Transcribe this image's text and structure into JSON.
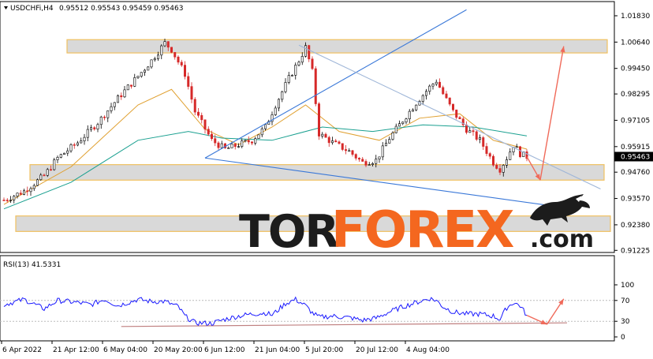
{
  "chart_data": [
    {
      "type": "candlestick",
      "header": {
        "symbol": "USDCHFi,H4",
        "values": "0.95512 0.95543 0.95459 0.95463"
      },
      "ylim": [
        0.912,
        1.024
      ],
      "y_ticks": [
        "1.01830",
        "1.00640",
        "0.99450",
        "0.98295",
        "0.97105",
        "0.95915",
        "0.94760",
        "0.93570",
        "0.92380",
        "0.91225"
      ],
      "y_tick_values": [
        1.0183,
        1.0064,
        0.9945,
        0.98295,
        0.97105,
        0.95915,
        0.9476,
        0.9357,
        0.9238,
        0.91225
      ],
      "current_price": "0.95463",
      "x_labels": [
        "6 Apr 2022",
        "21 Apr 12:00",
        "6 May 04:00",
        "20 May 20:00",
        "6 Jun 12:00",
        "21 Jun 04:00",
        "5 Jul 20:00",
        "20 Jul 12:00",
        "4 Aug 04:00"
      ],
      "price_path": [
        [
          0,
          0.935
        ],
        [
          6,
          0.939
        ],
        [
          12,
          0.946
        ],
        [
          16,
          0.954
        ],
        [
          22,
          0.961
        ],
        [
          28,
          0.97
        ],
        [
          34,
          0.981
        ],
        [
          40,
          0.991
        ],
        [
          44,
          0.998
        ],
        [
          48,
          1.006
        ],
        [
          50,
          1.003
        ],
        [
          54,
          0.992
        ],
        [
          57,
          0.975
        ],
        [
          62,
          0.962
        ],
        [
          66,
          0.958
        ],
        [
          70,
          0.96
        ],
        [
          74,
          0.962
        ],
        [
          78,
          0.968
        ],
        [
          81,
          0.978
        ],
        [
          85,
          0.99
        ],
        [
          88,
          0.998
        ],
        [
          90,
          1.004
        ],
        [
          92,
          0.993
        ],
        [
          94,
          0.965
        ],
        [
          98,
          0.961
        ],
        [
          103,
          0.957
        ],
        [
          107,
          0.952
        ],
        [
          111,
          0.953
        ],
        [
          115,
          0.963
        ],
        [
          119,
          0.971
        ],
        [
          123,
          0.979
        ],
        [
          127,
          0.986
        ],
        [
          129,
          0.989
        ],
        [
          131,
          0.983
        ],
        [
          134,
          0.975
        ],
        [
          138,
          0.967
        ],
        [
          142,
          0.962
        ],
        [
          146,
          0.952
        ],
        [
          148,
          0.949
        ],
        [
          150,
          0.954
        ],
        [
          152,
          0.96
        ],
        [
          154,
          0.956
        ],
        [
          156,
          0.9546
        ]
      ],
      "levels": [
        {
          "name": "resistance-zone",
          "from": 1.0015,
          "to": 1.0075,
          "x_start": 15,
          "x_end": 156
        },
        {
          "name": "support-zone",
          "from": 0.944,
          "to": 0.951,
          "x_start": 0,
          "x_end": 156
        },
        {
          "name": "lower-support-zone",
          "from": 0.9208,
          "to": 0.9278,
          "x_start": 0,
          "x_end": 156
        }
      ],
      "moving_averages": [
        {
          "name": "ma-fast",
          "color": "#e0a030",
          "values": [
            [
              0,
              0.933
            ],
            [
              20,
              0.95
            ],
            [
              40,
              0.978
            ],
            [
              50,
              0.985
            ],
            [
              60,
              0.967
            ],
            [
              70,
              0.96
            ],
            [
              80,
              0.968
            ],
            [
              90,
              0.978
            ],
            [
              100,
              0.966
            ],
            [
              112,
              0.962
            ],
            [
              124,
              0.972
            ],
            [
              136,
              0.974
            ],
            [
              146,
              0.962
            ],
            [
              156,
              0.958
            ]
          ]
        },
        {
          "name": "ma-slow",
          "color": "#1aa090",
          "values": [
            [
              0,
              0.931
            ],
            [
              20,
              0.943
            ],
            [
              40,
              0.962
            ],
            [
              55,
              0.966
            ],
            [
              65,
              0.963
            ],
            [
              80,
              0.962
            ],
            [
              95,
              0.968
            ],
            [
              110,
              0.966
            ],
            [
              125,
              0.969
            ],
            [
              140,
              0.968
            ],
            [
              156,
              0.964
            ]
          ]
        }
      ],
      "trendlines": [
        {
          "name": "rising-trendline",
          "color": "#3a78d8",
          "from": [
            60,
            0.954
          ],
          "to": [
            138,
            1.021
          ]
        },
        {
          "name": "falling-resistance-line",
          "color": "#9fb6d8",
          "from": [
            88,
            1.005
          ],
          "to": [
            178,
            0.94
          ]
        },
        {
          "name": "falling-support-line",
          "color": "#3a78d8",
          "from": [
            60,
            0.954
          ],
          "to": [
            170,
            0.931
          ]
        }
      ],
      "forecast": {
        "color": "#f06a5a",
        "points": [
          [
            156,
            0.9546
          ],
          [
            160,
            0.944
          ],
          [
            167,
            1.0045
          ]
        ]
      }
    },
    {
      "type": "line",
      "label": "RSI(13) 41.5331",
      "ylim": [
        0,
        100
      ],
      "y_ticks": [
        "100",
        "70",
        "30",
        "0"
      ],
      "y_tick_values": [
        100,
        70,
        30,
        0
      ],
      "series": [
        {
          "values": [
            [
              0,
              62
            ],
            [
              6,
              72
            ],
            [
              12,
              54
            ],
            [
              16,
              70
            ],
            [
              22,
              66
            ],
            [
              26,
              62
            ],
            [
              30,
              72
            ],
            [
              34,
              60
            ],
            [
              40,
              72
            ],
            [
              44,
              68
            ],
            [
              48,
              68
            ],
            [
              52,
              58
            ],
            [
              54,
              40
            ],
            [
              57,
              27
            ],
            [
              62,
              26
            ],
            [
              66,
              34
            ],
            [
              70,
              40
            ],
            [
              74,
              44
            ],
            [
              78,
              46
            ],
            [
              80,
              42
            ],
            [
              84,
              64
            ],
            [
              87,
              72
            ],
            [
              90,
              60
            ],
            [
              92,
              46
            ],
            [
              94,
              38
            ],
            [
              98,
              40
            ],
            [
              103,
              37
            ],
            [
              107,
              32
            ],
            [
              111,
              36
            ],
            [
              115,
              48
            ],
            [
              119,
              58
            ],
            [
              123,
              66
            ],
            [
              127,
              74
            ],
            [
              129,
              70
            ],
            [
              131,
              58
            ],
            [
              134,
              48
            ],
            [
              138,
              44
            ],
            [
              142,
              44
            ],
            [
              146,
              40
            ],
            [
              148,
              34
            ],
            [
              150,
              56
            ],
            [
              152,
              66
            ],
            [
              154,
              60
            ],
            [
              156,
              41.5
            ]
          ]
        }
      ],
      "trendlines": [
        {
          "name": "rsi-support-line",
          "color": "#c08080",
          "from": [
            35,
            20
          ],
          "to": [
            168,
            27
          ]
        }
      ],
      "forecast": {
        "color": "#f06a5a",
        "points": [
          [
            156,
            41.5
          ],
          [
            162,
            24
          ],
          [
            167,
            73
          ]
        ]
      }
    }
  ],
  "overlays": {
    "watermark_brand": "TORFOREX.com",
    "brand_prefix": "TOR",
    "brand_main": "FOREX",
    "brand_suffix": ".com",
    "logo_icon": "bull-icon",
    "brand_colors": {
      "dark": "#1c1c1c",
      "accent": "#f4671f",
      "candle_up": "#000000",
      "candle_down": "#d62828"
    }
  }
}
